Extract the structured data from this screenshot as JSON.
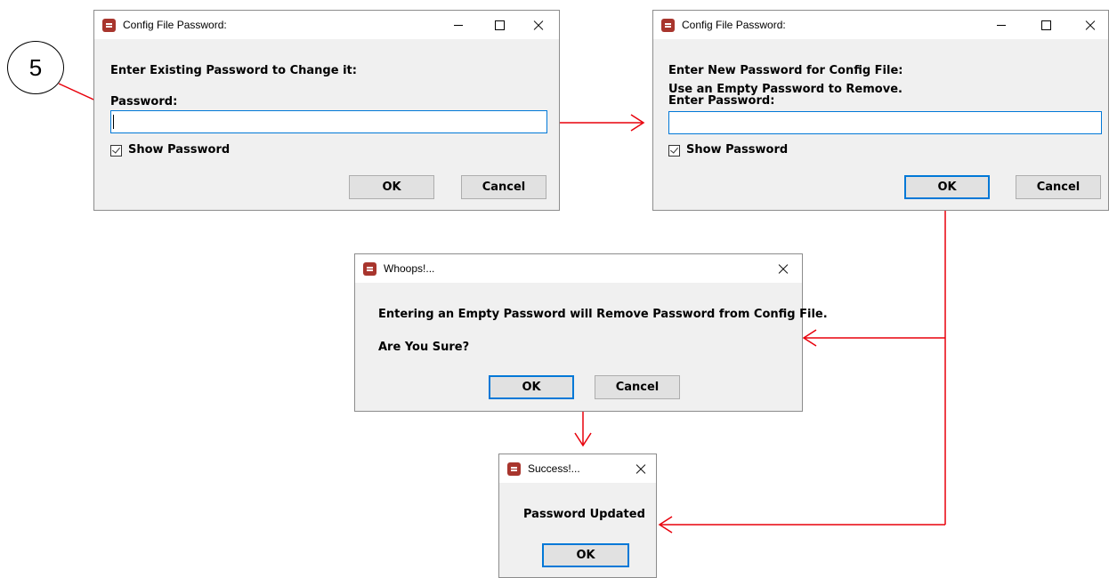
{
  "callout": {
    "number": "5"
  },
  "dialog_existing": {
    "title": "Config File Password:",
    "prompt": "Enter Existing Password to Change it:",
    "field_label": "Password:",
    "password_value": "",
    "show_password_label": "Show Password",
    "show_password_checked": true,
    "ok_label": "OK",
    "cancel_label": "Cancel"
  },
  "dialog_new": {
    "title": "Config File Password:",
    "prompt_line1": "Enter New Password for Config File:",
    "prompt_line2": "Use an Empty Password to Remove.",
    "prompt_line3": "Enter Password:",
    "password_value": "",
    "show_password_label": "Show Password",
    "show_password_checked": true,
    "ok_label": "OK",
    "cancel_label": "Cancel"
  },
  "dialog_whoops": {
    "title": "Whoops!...",
    "message": "Entering an Empty Password will Remove Password from Config File.",
    "question": "Are You Sure?",
    "ok_label": "OK",
    "cancel_label": "Cancel"
  },
  "dialog_success": {
    "title": "Success!...",
    "message": "Password Updated",
    "ok_label": "OK"
  },
  "colors": {
    "arrow": "#e8000b",
    "focus_border": "#0078d7",
    "app_icon": "#a8352d"
  }
}
